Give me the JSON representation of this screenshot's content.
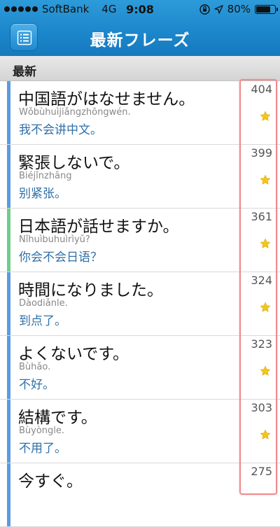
{
  "status": {
    "carrier": "SoftBank",
    "network": "4G",
    "time": "9:08",
    "battery_percent": "80%",
    "battery_level": 0.8
  },
  "nav": {
    "title": "最新フレーズ",
    "menu_icon": "list-icon"
  },
  "section": {
    "title": "最新"
  },
  "phrases": [
    {
      "jp": "中国語がはなせません。",
      "pinyin": "Wǒbùhuìjiǎngzhōngwén.",
      "zh": "我不会讲中文。",
      "count": "404",
      "bar_color": "#5b9be0",
      "starred": true
    },
    {
      "jp": "緊張しないで。",
      "pinyin": "Biéjǐnzhāng",
      "zh": "别紧张。",
      "count": "399",
      "bar_color": "#5b9be0",
      "starred": true
    },
    {
      "jp": "日本語が話せますか。",
      "pinyin": "Nǐhuìbuhuìrìyǔ?",
      "zh": "你会不会日语？",
      "count": "361",
      "bar_color": "#6fcd8a",
      "starred": true
    },
    {
      "jp": "時間になりました。",
      "pinyin": "Dàodiǎnle.",
      "zh": "到点了。",
      "count": "324",
      "bar_color": "#5b9be0",
      "starred": true
    },
    {
      "jp": "よくないです。",
      "pinyin": "Bùhǎo.",
      "zh": "不好。",
      "count": "323",
      "bar_color": "#5b9be0",
      "starred": true
    },
    {
      "jp": "結構です。",
      "pinyin": "Bùyòngle.",
      "zh": "不用了。",
      "count": "303",
      "bar_color": "#5b9be0",
      "starred": true
    },
    {
      "jp": "今すぐ。",
      "pinyin": "",
      "zh": "",
      "count": "275",
      "bar_color": "#5b9be0",
      "starred": false
    }
  ],
  "colors": {
    "accent": "#1b86cb",
    "star": "#f5c518",
    "highlight": "#f08b8b"
  }
}
